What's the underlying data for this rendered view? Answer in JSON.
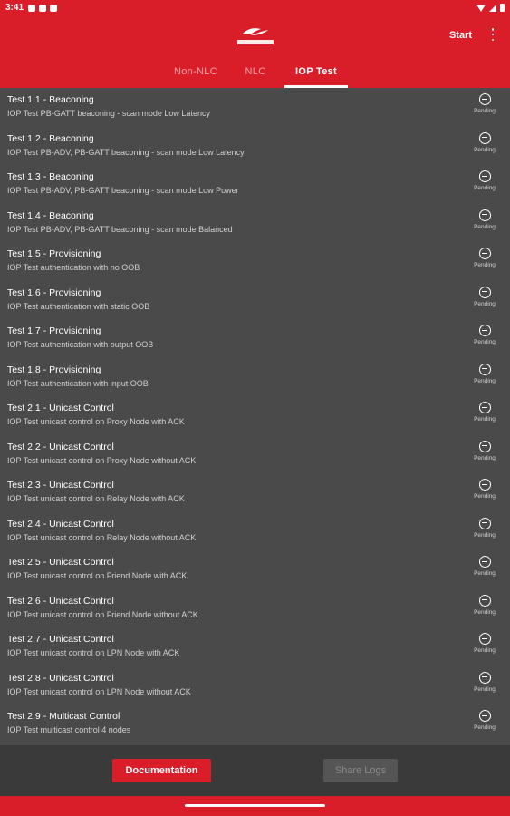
{
  "status_bar": {
    "time": "3:41"
  },
  "app_bar": {
    "start_label": "Start",
    "logo_text": "SILICON LABS"
  },
  "tabs": [
    {
      "label": "Non-NLC"
    },
    {
      "label": "NLC"
    },
    {
      "label": "IOP Test",
      "active": true
    }
  ],
  "tests": [
    {
      "title": "Test 1.1 - Beaconing",
      "description": "IOP Test PB-GATT beaconing - scan mode Low Latency",
      "status": "Pending"
    },
    {
      "title": "Test 1.2 - Beaconing",
      "description": "IOP Test PB-ADV, PB-GATT beaconing - scan mode Low Latency",
      "status": "Pending"
    },
    {
      "title": "Test 1.3 - Beaconing",
      "description": "IOP Test PB-ADV, PB-GATT beaconing - scan mode Low Power",
      "status": "Pending"
    },
    {
      "title": "Test 1.4 - Beaconing",
      "description": "IOP Test PB-ADV, PB-GATT beaconing - scan mode Balanced",
      "status": "Pending"
    },
    {
      "title": "Test 1.5 - Provisioning",
      "description": "IOP Test authentication with no OOB",
      "status": "Pending"
    },
    {
      "title": "Test 1.6 - Provisioning",
      "description": "IOP Test authentication with static OOB",
      "status": "Pending"
    },
    {
      "title": "Test 1.7 - Provisioning",
      "description": "IOP Test authentication with output OOB",
      "status": "Pending"
    },
    {
      "title": "Test 1.8 - Provisioning",
      "description": "IOP Test authentication with input OOB",
      "status": "Pending"
    },
    {
      "title": "Test 2.1 - Unicast Control",
      "description": "IOP Test unicast control on Proxy Node with ACK",
      "status": "Pending"
    },
    {
      "title": "Test 2.2 - Unicast Control",
      "description": "IOP Test unicast control on Proxy Node without ACK",
      "status": "Pending"
    },
    {
      "title": "Test 2.3 - Unicast Control",
      "description": "IOP Test unicast control on Relay Node with ACK",
      "status": "Pending"
    },
    {
      "title": "Test 2.4 - Unicast Control",
      "description": "IOP Test unicast control on Relay Node without ACK",
      "status": "Pending"
    },
    {
      "title": "Test 2.5 - Unicast Control",
      "description": "IOP Test unicast control on Friend Node with ACK",
      "status": "Pending"
    },
    {
      "title": "Test 2.6 - Unicast Control",
      "description": "IOP Test unicast control on Friend Node without ACK",
      "status": "Pending"
    },
    {
      "title": "Test 2.7 - Unicast Control",
      "description": "IOP Test unicast control on LPN Node with ACK",
      "status": "Pending"
    },
    {
      "title": "Test 2.8 - Unicast Control",
      "description": "IOP Test unicast control on LPN Node without ACK",
      "status": "Pending"
    },
    {
      "title": "Test 2.9 - Multicast Control",
      "description": "IOP Test multicast control 4 nodes",
      "status": "Pending"
    }
  ],
  "footer": {
    "documentation_label": "Documentation",
    "share_logs_label": "Share Logs"
  },
  "colors": {
    "brand_red": "#d91e2a",
    "background": "#4a4a4a",
    "footer_bg": "#3a3a3a"
  }
}
